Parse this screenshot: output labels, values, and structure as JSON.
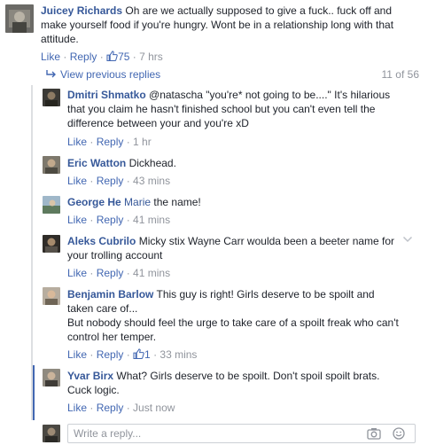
{
  "top_comment": {
    "author": "Juicey Richards",
    "text_line1": "Oh are we actually supposed to give a fuck.. fuck off and",
    "text_line2": "make yourself food if you're hungry. Wont be in a relationship long with that",
    "text_line3": "attitude.",
    "like_label": "Like",
    "reply_label": "Reply",
    "like_count": "75",
    "time": "7 hrs"
  },
  "replies_header": {
    "view_previous": "View previous replies",
    "count": "11 of 56"
  },
  "replies": [
    {
      "author": "Dmitri Shmatko",
      "line1": "@natascha \"you're* not going to be....\" It's hilarious",
      "line2": "that you claim he hasn't finished school but you can't even tell the",
      "line3": "difference between your and you're xD",
      "like_label": "Like",
      "reply_label": "Reply",
      "time": "1 hr"
    },
    {
      "author": "Eric Watton",
      "line1": "Dickhead.",
      "like_label": "Like",
      "reply_label": "Reply",
      "time": "43 mins"
    },
    {
      "author": "George He",
      "mention": "Marie",
      "line1": "the name!",
      "like_label": "Like",
      "reply_label": "Reply",
      "time": "41 mins"
    },
    {
      "author": "Aleks Cubrilo",
      "line1": "Micky stix Wayne Carr woulda been a beeter name for",
      "line2": "your trolling account",
      "like_label": "Like",
      "reply_label": "Reply",
      "time": "41 mins"
    },
    {
      "author": "Benjamin Barlow",
      "line1": "This guy is right! Girls deserve to be spoilt and",
      "line2": "taken care of...",
      "line3": "But nobody should feel the urge to take care of a spoilt freak who can't",
      "line4": "control her temper.",
      "like_label": "Like",
      "reply_label": "Reply",
      "like_count": "1",
      "time": "33 mins"
    },
    {
      "author": "Yvar Birx",
      "line1": "What? Girls deserve to be spoilt. Don't spoil spoilt brats.",
      "line2": "Cuck logic.",
      "like_label": "Like",
      "reply_label": "Reply",
      "time": "Just now"
    }
  ],
  "reply_box": {
    "placeholder": "Write a reply..."
  },
  "colors": {
    "author": "#365899",
    "link": "#4267b2",
    "meta": "#90949c",
    "text": "#1d2129",
    "thread_line": "#dddfe2"
  }
}
